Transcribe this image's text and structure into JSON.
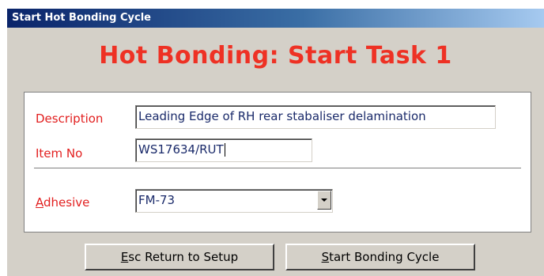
{
  "window": {
    "title": "Start Hot Bonding Cycle"
  },
  "heading": "Hot Bonding: Start Task 1",
  "form": {
    "description": {
      "label": "Description",
      "value": "Leading Edge of RH rear stabaliser delamination"
    },
    "item_no": {
      "label": "Item No",
      "value": "WS17634/RUT"
    },
    "adhesive": {
      "label_first": "A",
      "label_rest": "dhesive",
      "value": "FM-73"
    }
  },
  "buttons": {
    "return": {
      "first": "E",
      "rest": "sc Return to Setup"
    },
    "start": {
      "first": "S",
      "rest": "tart Bonding Cycle"
    }
  },
  "colors": {
    "heading": "#ee3124",
    "label": "#e21f1f",
    "field_text": "#1a2a6a",
    "dialog_bg": "#d4d0c8",
    "titlebar_start": "#0a246a",
    "titlebar_end": "#a6caf0"
  }
}
